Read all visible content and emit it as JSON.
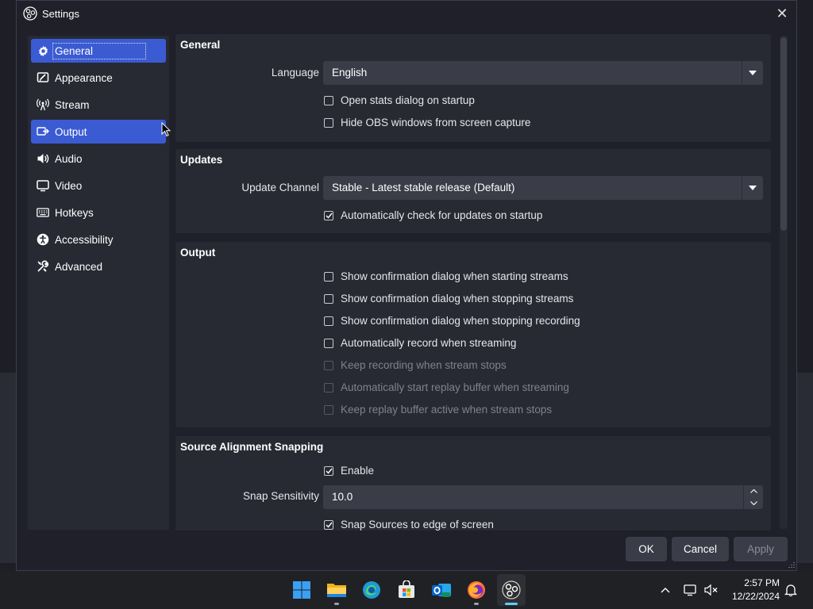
{
  "window": {
    "title": "Settings",
    "close_label": "✕"
  },
  "sidebar": {
    "items": [
      {
        "label": "General",
        "icon": "gear-icon",
        "selected": true
      },
      {
        "label": "Appearance",
        "icon": "appearance-icon"
      },
      {
        "label": "Stream",
        "icon": "antenna-icon"
      },
      {
        "label": "Output",
        "icon": "output-icon",
        "hover": true
      },
      {
        "label": "Audio",
        "icon": "speaker-icon"
      },
      {
        "label": "Video",
        "icon": "monitor-icon"
      },
      {
        "label": "Hotkeys",
        "icon": "keyboard-icon"
      },
      {
        "label": "Accessibility",
        "icon": "accessibility-icon"
      },
      {
        "label": "Advanced",
        "icon": "tools-icon"
      }
    ]
  },
  "general": {
    "title": "General",
    "language_label": "Language",
    "language_value": "English",
    "open_stats": {
      "label": "Open stats dialog on startup",
      "checked": false
    },
    "hide_obs": {
      "label": "Hide OBS windows from screen capture",
      "checked": false
    }
  },
  "updates": {
    "title": "Updates",
    "channel_label": "Update Channel",
    "channel_value": "Stable - Latest stable release (Default)",
    "auto_check": {
      "label": "Automatically check for updates on startup",
      "checked": true
    }
  },
  "output": {
    "title": "Output",
    "options": [
      {
        "label": "Show confirmation dialog when starting streams",
        "checked": false,
        "enabled": true
      },
      {
        "label": "Show confirmation dialog when stopping streams",
        "checked": false,
        "enabled": true
      },
      {
        "label": "Show confirmation dialog when stopping recording",
        "checked": false,
        "enabled": true
      },
      {
        "label": "Automatically record when streaming",
        "checked": false,
        "enabled": true
      },
      {
        "label": "Keep recording when stream stops",
        "checked": false,
        "enabled": false
      },
      {
        "label": "Automatically start replay buffer when streaming",
        "checked": false,
        "enabled": false
      },
      {
        "label": "Keep replay buffer active when stream stops",
        "checked": false,
        "enabled": false
      }
    ]
  },
  "snapping": {
    "title": "Source Alignment Snapping",
    "enable": {
      "label": "Enable",
      "checked": true
    },
    "sensitivity_label": "Snap Sensitivity",
    "sensitivity_value": "10.0",
    "snap_edge": {
      "label": "Snap Sources to edge of screen",
      "checked": true
    }
  },
  "buttons": {
    "ok": "OK",
    "cancel": "Cancel",
    "apply": "Apply"
  },
  "taskbar": {
    "apps": [
      "windows-start-icon",
      "file-explorer-icon",
      "edge-icon",
      "store-icon",
      "outlook-icon",
      "firefox-icon",
      "obs-icon"
    ],
    "active_app": "obs-icon",
    "time": "2:57 PM",
    "date": "12/22/2024"
  },
  "colors": {
    "accent": "#3b5bd3",
    "panel": "#272a33",
    "window": "#1f2029",
    "input": "#3a3d47"
  }
}
